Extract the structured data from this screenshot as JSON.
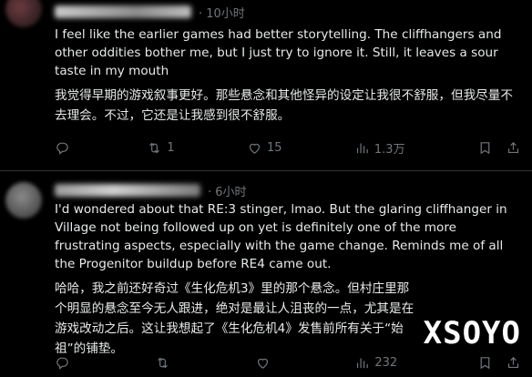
{
  "tweets": [
    {
      "time": "· 10小时",
      "en_text": "I feel like the earlier games had better storytelling. The cliffhangers and other oddities bother me, but I just try to ignore it. Still, it leaves a sour taste in my mouth",
      "zh_text": "我觉得早期的游戏叙事更好。那些悬念和其他怪异的设定让我很不舒服，但我尽量不去理会。不过，它还是让我感到很不舒服。",
      "actions": {
        "replies": "",
        "retweets": "1",
        "likes": "15",
        "views": "1.3万"
      }
    },
    {
      "time": "· 6小时",
      "en_text": "I'd wondered about that RE:3 stinger, lmao. But the glaring cliffhanger in Village not being followed up on yet is definitely one of the more frustrating aspects, especially with the game change. Reminds me of all the Progenitor buildup before RE4 came out.",
      "zh_text": "哈哈，我之前还好奇过《生化危机3》里的那个悬念。但村庄里那个明显的悬念至今无人跟进，绝对是最让人沮丧的一点，尤其是在游戏改动之后。这让我想起了《生化危机4》发售前所有关于“始祖”的铺垫。",
      "actions": {
        "replies": "",
        "retweets": "",
        "likes": "",
        "views": "232"
      }
    }
  ],
  "watermark": "XSOYO",
  "icons": [
    "reply-icon",
    "retweet-icon",
    "like-icon",
    "views-icon",
    "bookmark-icon",
    "share-icon"
  ]
}
